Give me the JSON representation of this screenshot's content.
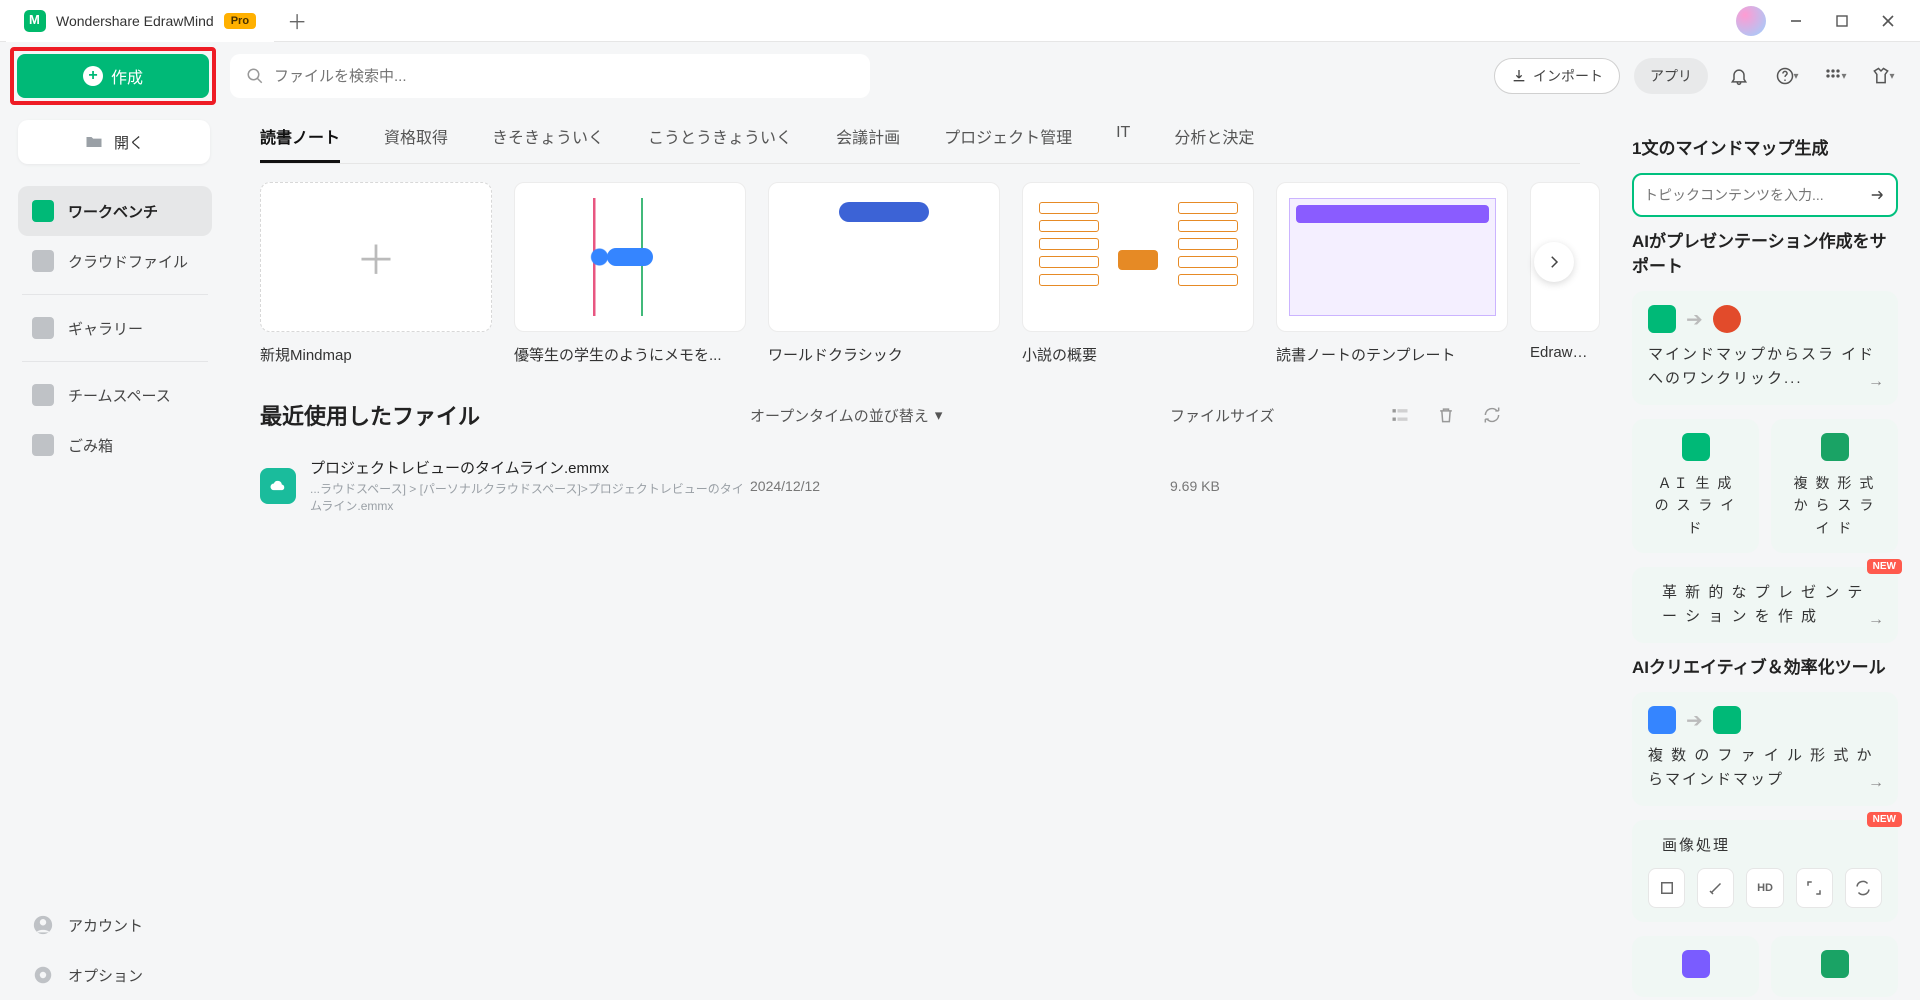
{
  "app": {
    "title": "Wondershare EdrawMind",
    "pro": "Pro"
  },
  "toolbar": {
    "create": "作成",
    "search_placeholder": "ファイルを検索中...",
    "import": "インポート",
    "apps": "アプリ"
  },
  "sidebar": {
    "open": "開く",
    "items": [
      "ワークベンチ",
      "クラウドファイル",
      "ギャラリー",
      "チームスペース",
      "ごみ箱"
    ],
    "footer": [
      "アカウント",
      "オプション"
    ]
  },
  "categories": [
    "読書ノート",
    "資格取得",
    "きそきょういく",
    "こうとうきょういく",
    "会議計画",
    "プロジェクト管理",
    "IT",
    "分析と決定"
  ],
  "templates": [
    {
      "title": "新規Mindmap"
    },
    {
      "title": "優等生の学生のようにメモを..."
    },
    {
      "title": "ワールドクラシック"
    },
    {
      "title": "小説の概要"
    },
    {
      "title": "読書ノートのテンプレート"
    },
    {
      "title": "EdrawMind"
    }
  ],
  "recent": {
    "heading": "最近使用したファイル",
    "sort_label": "オープンタイムの並び替え",
    "size_label": "ファイルサイズ",
    "file": {
      "name": "プロジェクトレビューのタイムライン.emmx",
      "path": "...ラウドスペース] > [パーソナルクラウドスペース]>プロジェクトレビューのタイムライン.emmx",
      "date": "2024/12/12",
      "size": "9.69 KB"
    }
  },
  "right": {
    "gen_heading": "1文のマインドマップ生成",
    "gen_placeholder": "トピックコンテンツを入力...",
    "ai_pres_heading": "AIがプレゼンテーション作成をサポート",
    "card1": "マインドマップからスラ\nイドへのワンクリック...",
    "card2a": "ＡＩ 生 成 の ス\nラ イ ド",
    "card2b": "複 数 形 式 か\nら ス ラ イ ド",
    "card3": "革 新 的 な プ レ ゼ ン テ ー\nシ ョ ン を 作 成",
    "tools_heading": "AIクリエイティブ＆効率化ツール",
    "card4": "複 数 の フ ァ イ ル 形 式 か\nらマインドマップ",
    "img_proc": "画像処理",
    "new_badge": "NEW"
  }
}
